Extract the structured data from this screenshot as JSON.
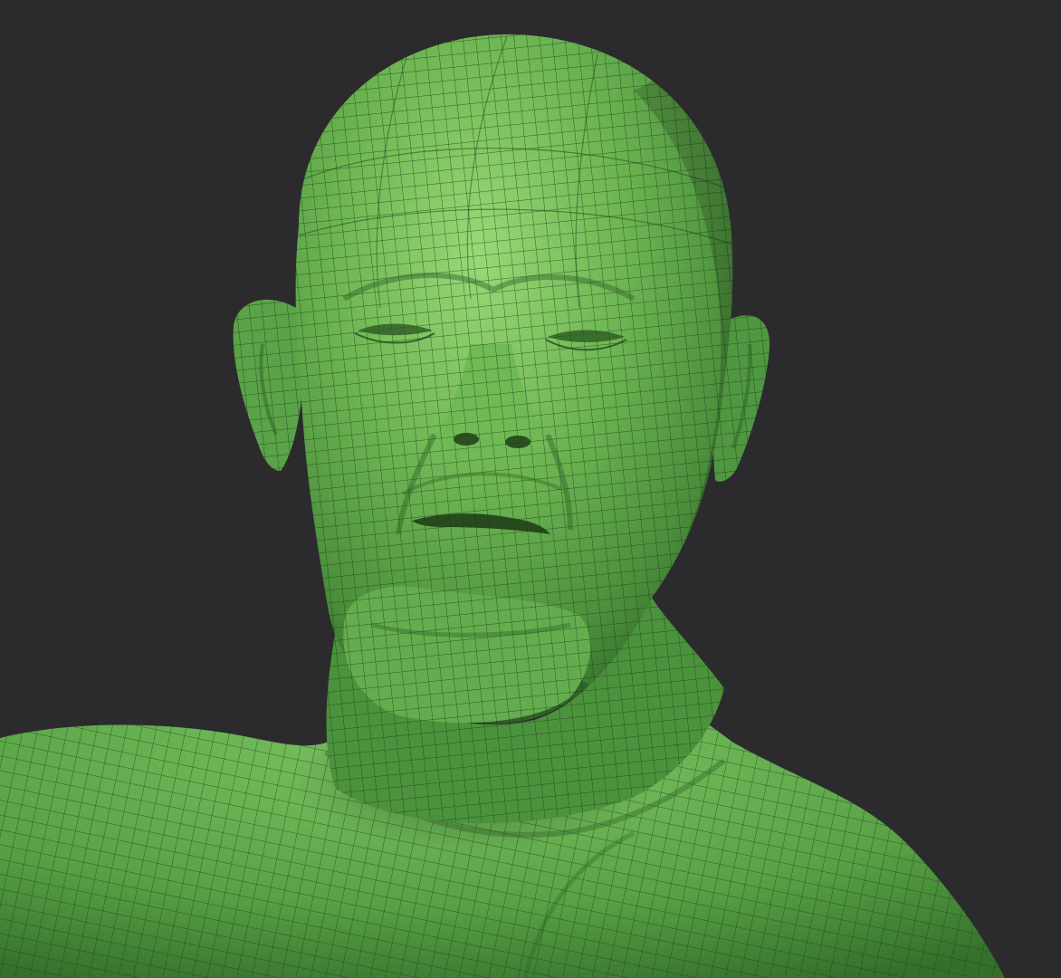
{
  "scene": {
    "background_color": "#2b2b2d",
    "mesh_color": "#5fa84a",
    "mesh_highlight": "#8fd06d",
    "mesh_shadow": "#2f6a25",
    "wire_color": "#1c3a16",
    "subject": "wireframe-sculpted-head-bust"
  }
}
